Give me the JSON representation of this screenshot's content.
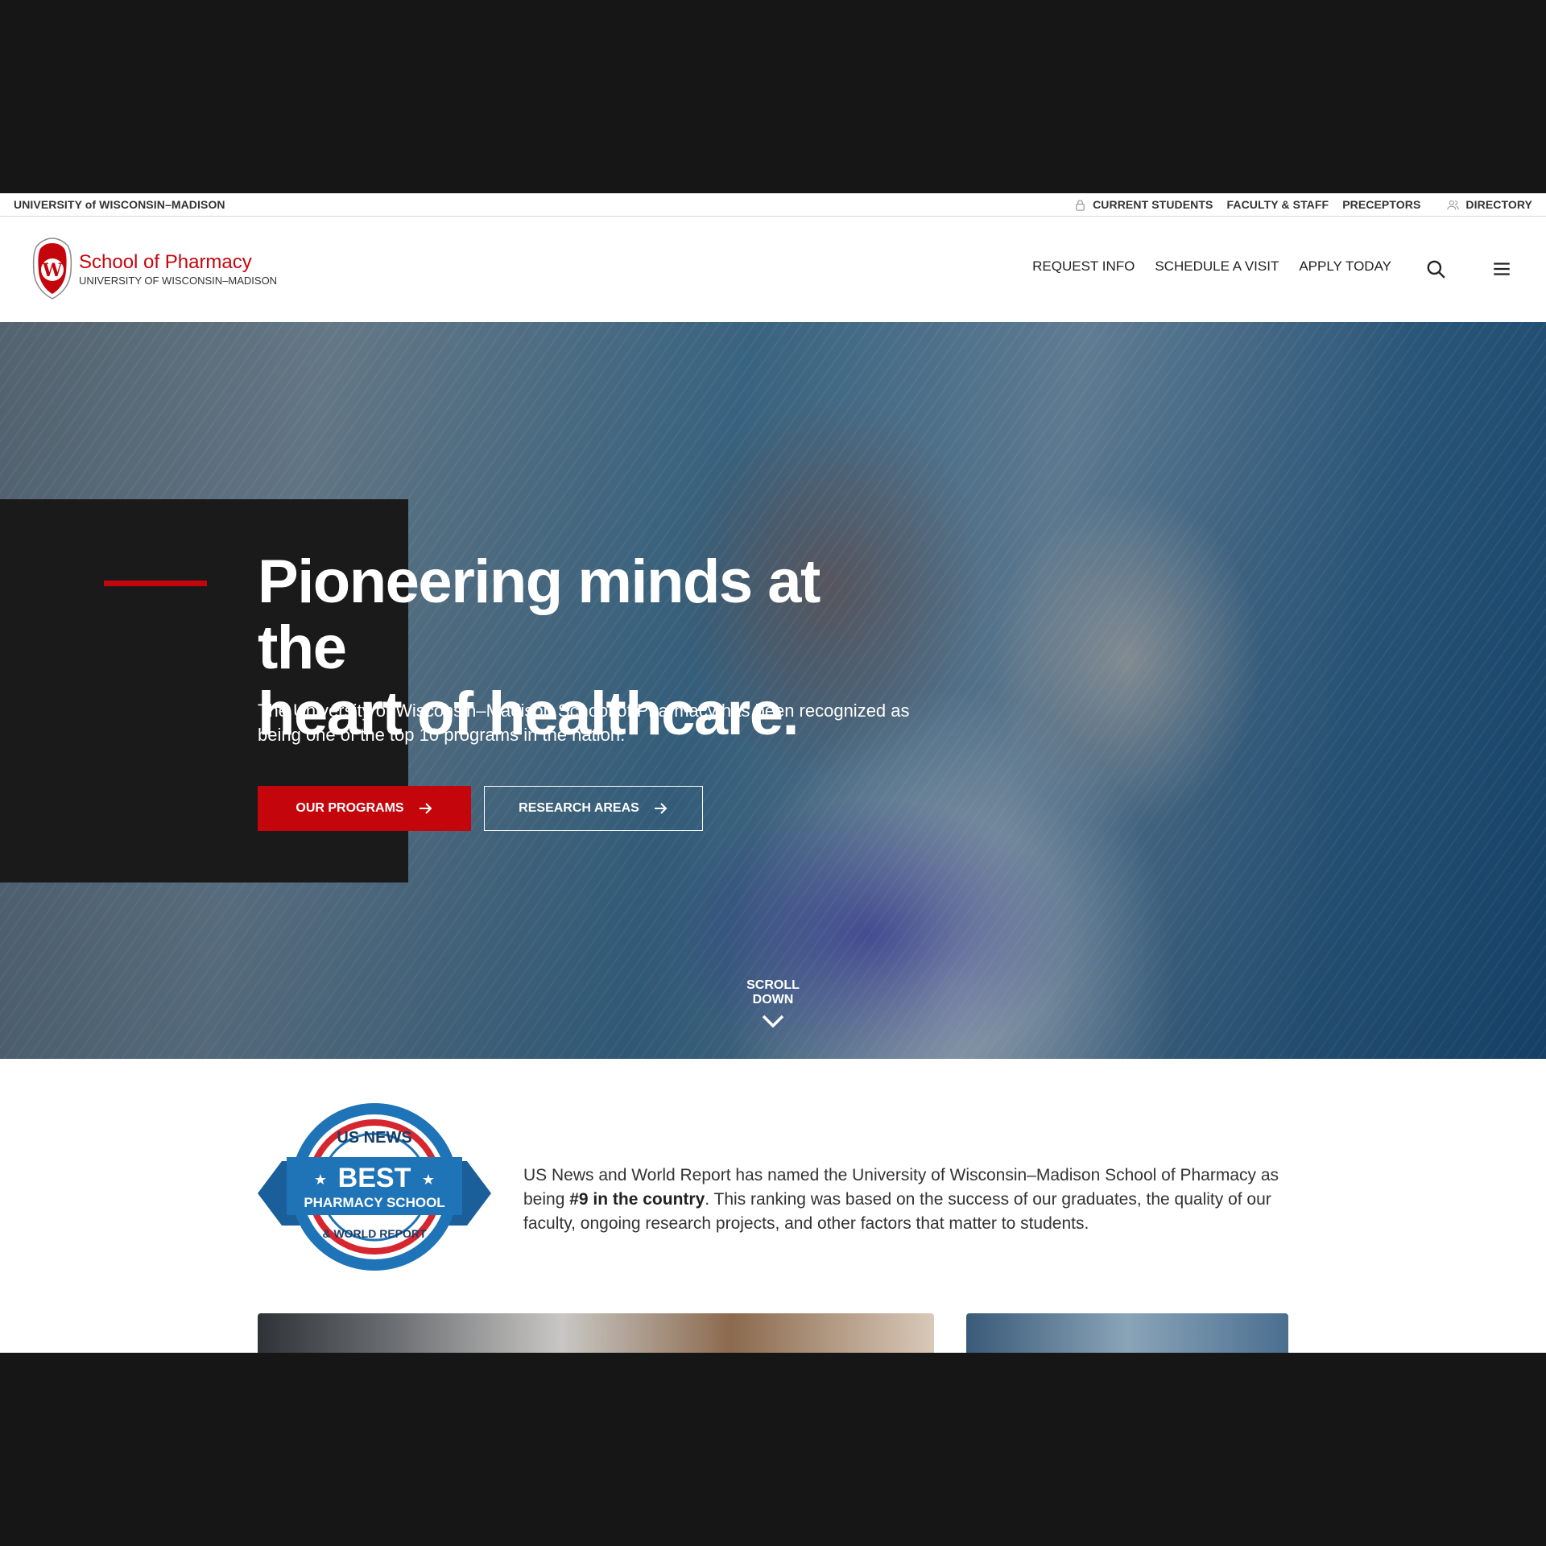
{
  "utility": {
    "brand": "UNIVERSITY of WISCONSIN–MADISON",
    "links": [
      "CURRENT STUDENTS",
      "FACULTY & STAFF",
      "PRECEPTORS"
    ],
    "directory": "DIRECTORY"
  },
  "header": {
    "logo_title": "School of Pharmacy",
    "logo_subtitle": "UNIVERSITY OF WISCONSIN–MADISON",
    "crest_letter": "W",
    "nav": [
      "REQUEST INFO",
      "SCHEDULE A VISIT",
      "APPLY TODAY"
    ]
  },
  "hero": {
    "title_line1": "Pioneering minds at the",
    "title_line2": "heart of healthcare.",
    "text": "The University of Wisconsin–Madison School of Pharmacy has been recognized as being one of the top 10 programs in the nation.",
    "primary_button": "OUR PROGRAMS",
    "secondary_button": "RESEARCH AREAS",
    "scroll_label": "SCROLL DOWN"
  },
  "ranking": {
    "badge_top": "US NEWS",
    "badge_main": "BEST",
    "badge_sub": "PHARMACY SCHOOL",
    "badge_bottom": "& WORLD REPORT",
    "text_before": "US News and World Report has named the University of Wisconsin–Madison School of Pharmacy as being ",
    "text_bold": "#9 in the country",
    "text_after": ". This ranking was based on the success of our graduates, the quality of our faculty, ongoing research projects, and other factors that matter to students."
  },
  "colors": {
    "accent": "#c5050c",
    "panel": "#1a1a1a",
    "badge_blue": "#1f73b7"
  },
  "icons": [
    "lock-icon",
    "people-icon",
    "search-icon",
    "menu-icon",
    "arrow-right-icon",
    "chevron-down-icon"
  ]
}
